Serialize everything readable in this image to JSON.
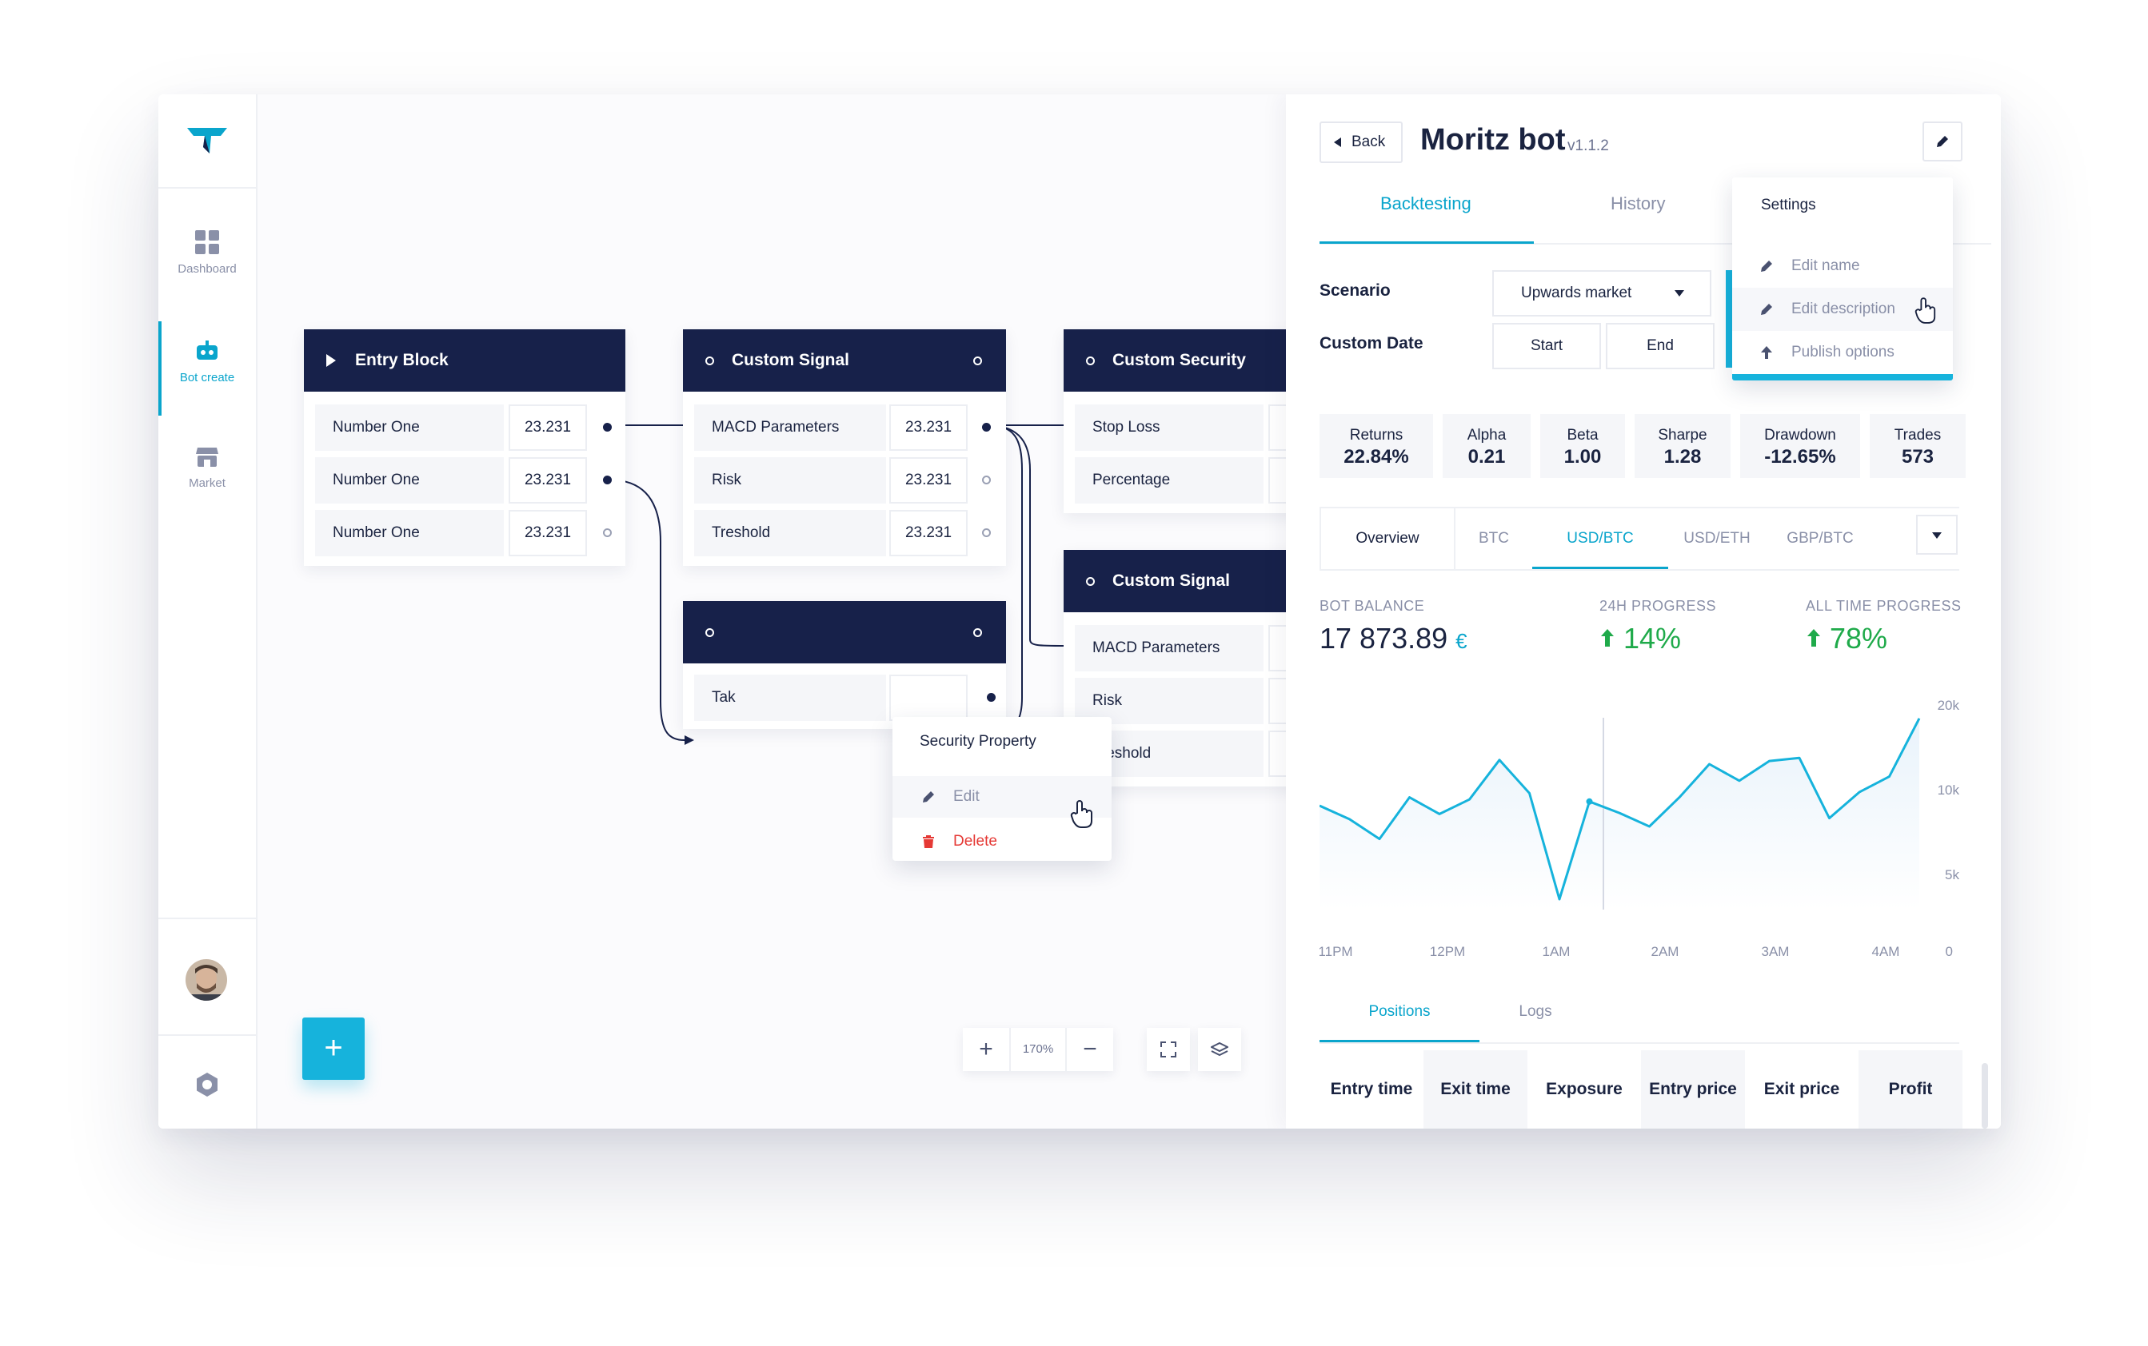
{
  "sidebar": {
    "items": [
      {
        "label": "Dashboard",
        "icon": "dashboard-icon"
      },
      {
        "label": "Bot create",
        "icon": "bot-icon",
        "active": true
      },
      {
        "label": "Market",
        "icon": "market-icon"
      }
    ]
  },
  "canvas": {
    "entry_block": {
      "title": "Entry Block",
      "rows": [
        {
          "label": "Number One",
          "value": "23.231"
        },
        {
          "label": "Number One",
          "value": "23.231"
        },
        {
          "label": "Number One",
          "value": "23.231"
        }
      ]
    },
    "custom_signal_1": {
      "title": "Custom Signal",
      "rows": [
        {
          "label": "MACD Parameters",
          "value": "23.231"
        },
        {
          "label": "Risk",
          "value": "23.231"
        },
        {
          "label": "Treshold",
          "value": "23.231"
        }
      ]
    },
    "security_block": {
      "row_label": "Tak"
    },
    "custom_security": {
      "title": "Custom Security",
      "rows": [
        {
          "label": "Stop Loss"
        },
        {
          "label": "Percentage"
        }
      ]
    },
    "custom_signal_2": {
      "title": "Custom Signal",
      "rows": [
        {
          "label": "MACD Parameters"
        },
        {
          "label": "Risk"
        },
        {
          "label": "Treshold"
        }
      ]
    },
    "context_menu": {
      "title": "Security Property",
      "edit": "Edit",
      "delete": "Delete"
    },
    "fab_label": "+",
    "zoom": {
      "plus": "+",
      "value": "170%",
      "minus": "−"
    }
  },
  "panel": {
    "back": "Back",
    "title": "Moritz bot",
    "version": "v1.1.2",
    "tabs": [
      "Backtesting",
      "History"
    ],
    "scenario_label": "Scenario",
    "scenario_value": "Upwards market",
    "custom_date_label": "Custom Date",
    "start": "Start",
    "end": "End",
    "settings_menu": {
      "title": "Settings",
      "items": [
        "Edit name",
        "Edit description",
        "Publish options"
      ]
    },
    "stats": [
      {
        "label": "Returns",
        "value": "22.84%"
      },
      {
        "label": "Alpha",
        "value": "0.21"
      },
      {
        "label": "Beta",
        "value": "1.00"
      },
      {
        "label": "Sharpe",
        "value": "1.28"
      },
      {
        "label": "Drawdown",
        "value": "-12.65%"
      },
      {
        "label": "Trades",
        "value": "573"
      }
    ],
    "pair_tabs": [
      "Overview",
      "BTC",
      "USD/BTC",
      "USD/ETH",
      "GBP/BTC"
    ],
    "kpis": {
      "balance_label": "BOT BALANCE",
      "balance_value": "17 873.89",
      "balance_currency": "€",
      "progress24_label": "24H PROGRESS",
      "progress24_value": "14%",
      "alltime_label": "ALL TIME PROGRESS",
      "alltime_value": "78%"
    },
    "bottom_tabs": [
      "Positions",
      "Logs"
    ],
    "table_headers": [
      "Entry time",
      "Exit time",
      "Exposure",
      "Entry price",
      "Exit price",
      "Profit"
    ]
  },
  "colors": {
    "accent": "#0aa5cc",
    "navy": "#17214a",
    "positive": "#1faa4a",
    "danger": "#e53935"
  },
  "chart_data": {
    "type": "line",
    "x": [
      "11PM",
      "12PM",
      "1AM",
      "2AM",
      "3AM",
      "4AM"
    ],
    "x_tick_labels": [
      "11PM",
      "12PM",
      "1AM",
      "2AM",
      "3AM",
      "4AM",
      "0"
    ],
    "y_tick_labels": [
      "20k",
      "10k",
      "5k"
    ],
    "ylim": [
      0,
      20000
    ],
    "series": [
      {
        "values": [
          10000,
          8700,
          6800,
          10800,
          9200,
          10600,
          14400,
          11200,
          1000,
          10400,
          9300,
          8000,
          10800,
          14000,
          12400,
          14300,
          14600,
          8800,
          11300,
          12800,
          18400
        ]
      }
    ]
  }
}
